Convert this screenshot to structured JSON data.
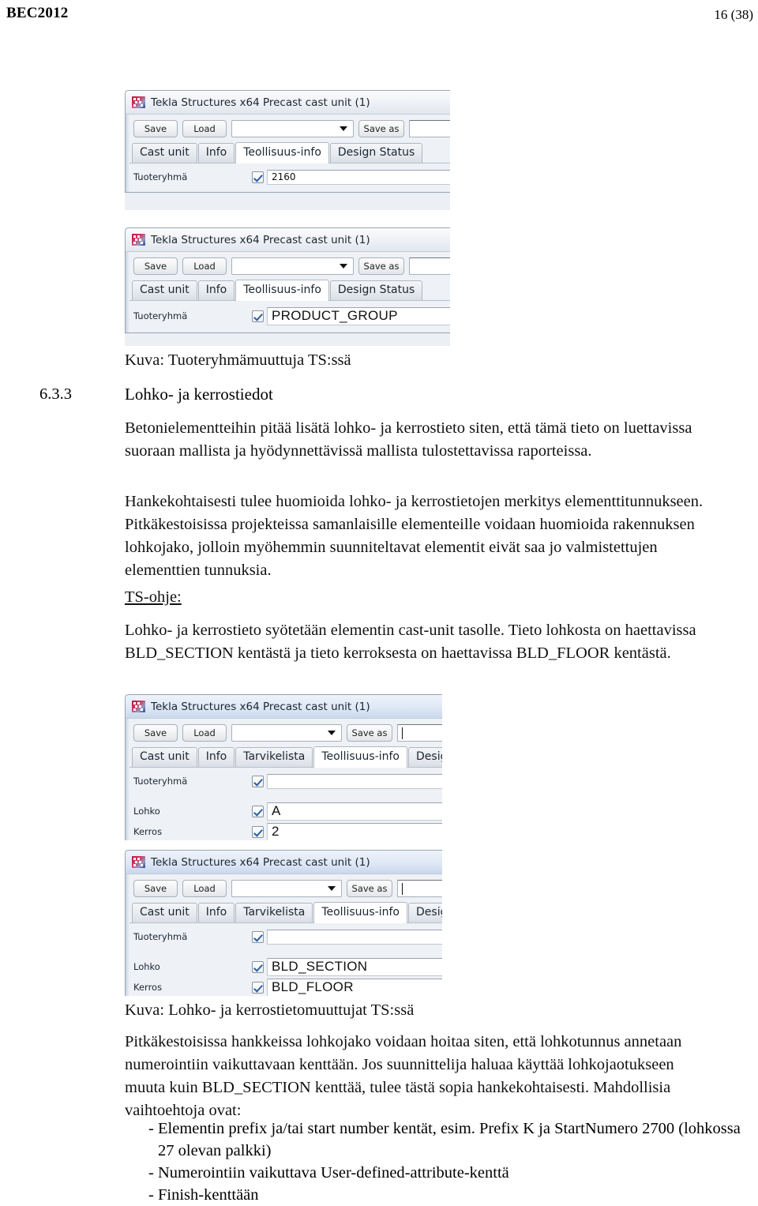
{
  "header": {
    "left": "BEC2012",
    "right": "16 (38)"
  },
  "figure1": {
    "title": "Tekla Structures x64  Precast cast unit (1)",
    "buttons": {
      "save": "Save",
      "load": "Load",
      "save_as": "Save as"
    },
    "combo_value": "",
    "name_field_value": "",
    "tabs": [
      "Cast unit",
      "Info",
      "Teollisuus-info",
      "Design Status"
    ],
    "active_tab": "Teollisuus-info",
    "rows": [
      {
        "label": "Tuoteryhmä",
        "checked": true,
        "value": "2160",
        "big": false
      }
    ]
  },
  "figure2": {
    "title": "Tekla Structures x64  Precast cast unit (1)",
    "buttons": {
      "save": "Save",
      "load": "Load",
      "save_as": "Save as"
    },
    "combo_value": "",
    "name_field_value": "",
    "tabs": [
      "Cast unit",
      "Info",
      "Teollisuus-info",
      "Design Status"
    ],
    "active_tab": "Teollisuus-info",
    "rows": [
      {
        "label": "Tuoteryhmä",
        "checked": true,
        "value": "PRODUCT_GROUP",
        "big": true
      }
    ]
  },
  "caption1": "Kuva: Tuoteryhmämuuttuja TS:ssä",
  "section": {
    "number": "6.3.3",
    "title": "Lohko- ja kerrostiedot"
  },
  "paragraphs": {
    "p1": "Betonielementteihin pitää lisätä lohko- ja kerrostieto siten, että tämä tieto on luettavissa suoraan mallista ja hyödynnettävissä mallista tulostettavissa raporteissa.",
    "p2": "Hankekohtaisesti tulee huomioida lohko- ja kerrostietojen merkitys elementtitunnukseen. Pitkäkestoisissa projekteissa samanlaisille elementeille voidaan huomioida rakennuksen lohkojako, jolloin myöhemmin suunniteltavat elementit eivät saa jo valmistettujen elementtien tunnuksia.",
    "ts_ohje_label": "TS-ohje:",
    "p3": "Lohko- ja kerrostieto syötetään elementin cast-unit tasolle.  Tieto lohkosta on haettavissa BLD_SECTION kentästä ja tieto kerroksesta on haettavissa BLD_FLOOR kentästä.",
    "p4": "Pitkäkestoisissa hankkeissa lohkojako voidaan hoitaa siten, että lohkotunnus annetaan numerointiin vaikuttavaan kenttään. Jos suunnittelija haluaa käyttää lohkojaotukseen muuta kuin BLD_SECTION kenttää, tulee tästä sopia hankekohtaisesti. Mahdollisia vaihtoehtoja ovat:"
  },
  "figure3": {
    "title": "Tekla Structures x64  Precast cast unit (1)",
    "buttons": {
      "save": "Save",
      "load": "Load",
      "save_as": "Save as"
    },
    "combo_value": "",
    "name_field_value": "",
    "tabs": [
      "Cast unit",
      "Info",
      "Tarvikelista",
      "Teollisuus-info",
      "Design Status"
    ],
    "active_tab": "Teollisuus-info",
    "rows": [
      {
        "label": "Tuoteryhmä",
        "checked": true,
        "value": "",
        "big": false
      },
      {
        "label": "Lohko",
        "checked": true,
        "value": "A",
        "big": true
      },
      {
        "label": "Kerros",
        "checked": true,
        "value": "2",
        "big": true
      }
    ]
  },
  "figure4": {
    "title": "Tekla Structures x64  Precast cast unit (1)",
    "buttons": {
      "save": "Save",
      "load": "Load",
      "save_as": "Save as"
    },
    "combo_value": "",
    "name_field_value": "",
    "tabs": [
      "Cast unit",
      "Info",
      "Tarvikelista",
      "Teollisuus-info",
      "Design Status"
    ],
    "active_tab": "Teollisuus-info",
    "rows": [
      {
        "label": "Tuoteryhmä",
        "checked": true,
        "value": "",
        "big": false
      },
      {
        "label": "Lohko",
        "checked": true,
        "value": "BLD_SECTION",
        "big": true
      },
      {
        "label": "Kerros",
        "checked": true,
        "value": "BLD_FLOOR",
        "big": true
      }
    ]
  },
  "caption2": "Kuva: Lohko- ja kerrostietomuuttujat TS:ssä",
  "bullets": [
    {
      "dash": "-",
      "text": "Elementin prefix ja/tai start number kentät, esim. Prefix K ja StartNumero 2700 (lohkossa 27 olevan palkki)"
    },
    {
      "dash": "-",
      "text": "Numerointiin vaikuttava User-defined-attribute-kenttä"
    },
    {
      "dash": "-",
      "text": "Finish-kenttään"
    }
  ],
  "colors": {
    "accent": "#2a5fa5",
    "dialog_bg": "#eef1f5",
    "logo_red": "#b0143c",
    "logo_blue": "#2d3f86"
  }
}
